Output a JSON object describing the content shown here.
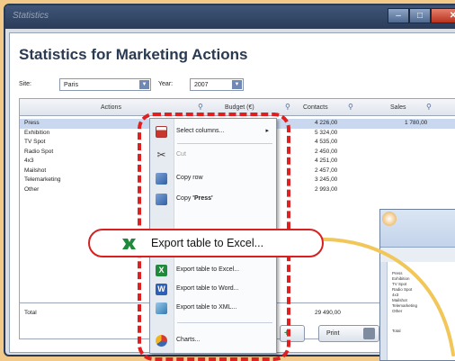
{
  "window": {
    "title": "Statistics",
    "buttons": {
      "minimize": "–",
      "maximize": "□",
      "close": "✕"
    }
  },
  "page": {
    "title": "Statistics for Marketing Actions",
    "filters": {
      "site_label": "Site:",
      "site_value": "Paris",
      "year_label": "Year:",
      "year_value": "2007"
    }
  },
  "grid": {
    "columns": [
      "Actions",
      "Budget (€)",
      "Contacts",
      "Sales"
    ],
    "rows": [
      {
        "action": "Press",
        "contacts": "4 226,00",
        "sales": "1 780,00"
      },
      {
        "action": "Exhibition",
        "contacts": "5 324,00",
        "sales": ""
      },
      {
        "action": "TV Spot",
        "contacts": "4 535,00",
        "sales": ""
      },
      {
        "action": "Radio Spot",
        "contacts": "2 450,00",
        "sales": ""
      },
      {
        "action": "4x3",
        "contacts": "4 251,00",
        "sales": ""
      },
      {
        "action": "Mailshot",
        "contacts": "2 457,00",
        "sales": ""
      },
      {
        "action": "Telemarketing",
        "contacts": "3 245,00",
        "sales": ""
      },
      {
        "action": "Other",
        "contacts": "2 993,00",
        "sales": ""
      }
    ],
    "total": {
      "label": "Total",
      "contacts": "29 490,00"
    }
  },
  "buttons": {
    "print": "Print"
  },
  "context_menu": {
    "select_columns": "Select columns...",
    "cut": "Cut",
    "copy_row": "Copy row",
    "copy_cell_prefix": "Copy ",
    "copy_cell_value": "'Press'",
    "export_excel": "Export table to Excel...",
    "export_word": "Export table to Word...",
    "export_xml": "Export table to XML...",
    "charts": "Charts..."
  },
  "callout": {
    "label": "Export table to Excel..."
  },
  "excel_preview": {
    "rows": [
      "Press",
      "Exhibition",
      "TV Spot",
      "Radio Spot",
      "4x3",
      "Mailshot",
      "Telemarketing",
      "Other"
    ],
    "total": "Total"
  },
  "colors": {
    "background": "#f3c98a",
    "highlight_red": "#e02020",
    "arrow_yellow": "#f1c75a",
    "excel_green": "#1f8a3b",
    "selected_row": "#c9d8ee"
  }
}
